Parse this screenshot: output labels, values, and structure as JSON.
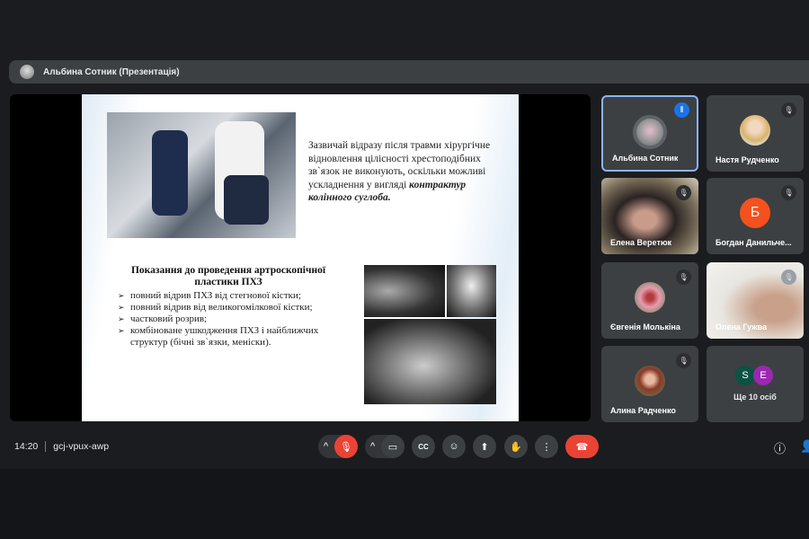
{
  "presentation_bar": {
    "title": "Альбина Сотник (Презентація)"
  },
  "slide": {
    "paragraph": "Зазвичай відразу після травми хірургічне відновлення цілісності хрестоподібних зв`язок не виконують, оскільки можливі ускладнення у вигляді ",
    "paragraph_emphasis": "контрактур колінного суглоба.",
    "heading": "Показання до проведення артроскопічної пластики ПХЗ",
    "bullets": [
      "повний відрив ПХЗ від стегнової кістки;",
      "повний відрив від великогомілкової кістки;",
      "частковий розрив;",
      "комбіноване ушкодження ПХЗ і найближчих структур (бічні зв`язки, меніски)."
    ]
  },
  "participants": [
    {
      "name": "Альбина Сотник",
      "speaking": true
    },
    {
      "name": "Настя Рудченко",
      "muted": true
    },
    {
      "name": "Елена Веретюк",
      "muted": true
    },
    {
      "name": "Богдан Данильче...",
      "initial": "Б",
      "muted": true
    },
    {
      "name": "Євгенія Молькіна",
      "muted": true
    },
    {
      "name": "Олена Гужва",
      "muted": true
    },
    {
      "name": "Алина Радченко",
      "muted": true
    }
  ],
  "more": {
    "label": "Ще 10 осіб",
    "initials": [
      "S",
      "E"
    ]
  },
  "meeting": {
    "time": "14:20",
    "code": "gcj-vpux-awp"
  },
  "colors": {
    "accent": "#8ab4f8",
    "danger": "#ea4335",
    "tile": "#3c4043",
    "avatar_b": "#f4511e",
    "avatar_s": "#0b5345",
    "avatar_e": "#9c27b0"
  }
}
